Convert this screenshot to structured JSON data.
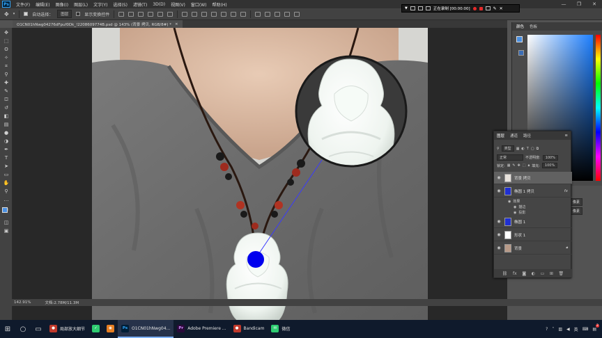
{
  "app": {
    "logo": "Ps",
    "menus": [
      "文件(F)",
      "编辑(E)",
      "图像(I)",
      "图层(L)",
      "文字(Y)",
      "选择(S)",
      "滤镜(T)",
      "3D(D)",
      "视图(V)",
      "窗口(W)",
      "帮助(H)"
    ]
  },
  "options": {
    "auto_select_label": "自动选择：",
    "auto_select_value": "图层",
    "show_transform_label": "显示变换控件"
  },
  "recording": {
    "status": "正在录制 [00:00:00]"
  },
  "document": {
    "tab_title": "O1CN01hNwg04276dFpuf0Dk_!2208609774B.psd @ 143% (背景 拷贝, RGB/8#) *",
    "close_glyph": "×"
  },
  "status": {
    "zoom": "142.91%",
    "doc_size": "文档:2.78M/11.3M"
  },
  "color_panel": {
    "tabs": [
      "颜色",
      "色板"
    ],
    "fg_color": "#4a90e2"
  },
  "layers_panel": {
    "tabs": [
      "图层",
      "通道",
      "路径"
    ],
    "filter_label": "类型",
    "blend_mode": "正常",
    "opacity_label": "不透明度:",
    "opacity_value": "100%",
    "lock_label": "锁定:",
    "fill_label": "填充:",
    "fill_value": "100%",
    "layers": [
      {
        "name": "背景 拷贝",
        "selected": true,
        "fx": ""
      },
      {
        "name": "椭圆 1 拷贝",
        "selected": false,
        "fx": "fx"
      },
      {
        "name": "椭圆 1",
        "selected": false,
        "fx": ""
      },
      {
        "name": "形状 1",
        "selected": false,
        "fx": ""
      },
      {
        "name": "背景",
        "selected": false,
        "fx": ""
      }
    ],
    "effects": {
      "header": "效果",
      "items": [
        "描边",
        "投影"
      ]
    },
    "bottom_icons": [
      "link-icon",
      "fx-icon",
      "mask-icon",
      "adjustment-icon",
      "folder-icon",
      "new-layer-icon",
      "trash-icon"
    ]
  },
  "side_chips": [
    "像素",
    "像素"
  ],
  "taskbar": {
    "apps": [
      {
        "label": "局部放大细节",
        "icon_bg": "#c0392b",
        "icon_text": "●",
        "active": false
      },
      {
        "label": "",
        "icon_bg": "#2ecc71",
        "icon_text": "✓",
        "active": false
      },
      {
        "label": "",
        "icon_bg": "#e67e22",
        "icon_text": "◉",
        "active": false
      },
      {
        "label": "O1CN01hNwg04...",
        "icon_bg": "#001e36",
        "icon_text": "Ps",
        "active": true
      },
      {
        "label": "Adobe Premiere ...",
        "icon_bg": "#2a0a3a",
        "icon_text": "Pr",
        "active": false
      },
      {
        "label": "Bandicam",
        "icon_bg": "#c0392b",
        "icon_text": "●",
        "active": false
      },
      {
        "label": "微信",
        "icon_bg": "#2ecc71",
        "icon_text": "✉",
        "active": false
      }
    ],
    "tray_lang": "英",
    "tray_badge": "2"
  }
}
